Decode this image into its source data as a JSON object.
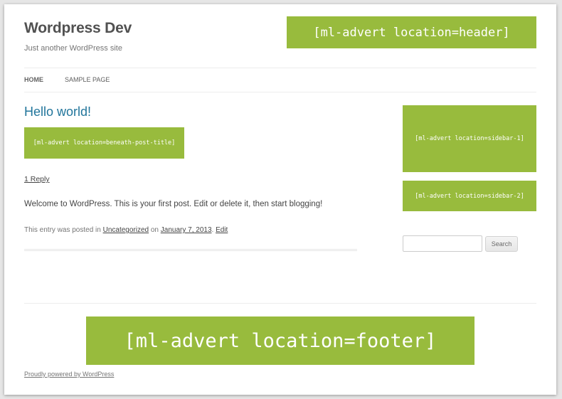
{
  "site": {
    "title": "Wordpress Dev",
    "description": "Just another WordPress site"
  },
  "ads": {
    "header": "[ml-advert location=header]",
    "beneath_post_title": "[ml-advert location=beneath-post-title]",
    "sidebar_1": "[ml-advert location=sidebar-1]",
    "sidebar_2": "[ml-advert location=sidebar-2]",
    "footer": "[ml-advert location=footer]"
  },
  "nav": {
    "items": [
      {
        "label": "HOME"
      },
      {
        "label": "SAMPLE PAGE"
      }
    ]
  },
  "post": {
    "title": "Hello world!",
    "reply_link": "1 Reply",
    "body": "Welcome to WordPress. This is your first post. Edit or delete it, then start blogging!",
    "meta": {
      "prefix": "This entry was posted in",
      "category": "Uncategorized",
      "on": "on",
      "date": "January 7, 2013",
      "separator": ".",
      "edit": "Edit"
    }
  },
  "search": {
    "value": "",
    "button_label": "Search"
  },
  "footer": {
    "credit": "Proudly powered by WordPress"
  },
  "colors": {
    "ad_green": "#98bb3d",
    "link_blue": "#21759b"
  }
}
